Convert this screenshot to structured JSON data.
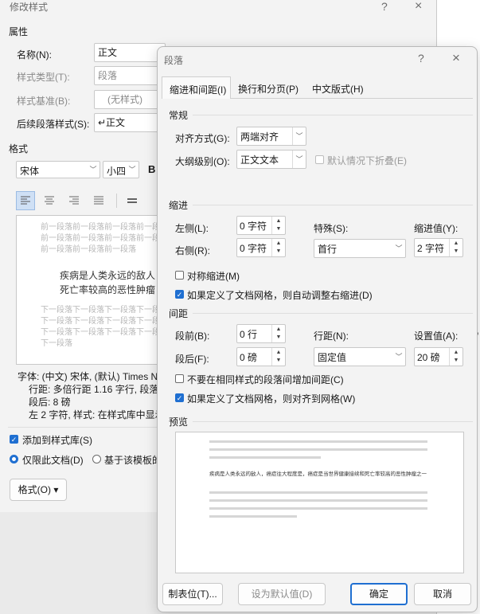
{
  "back": {
    "title": "修改样式",
    "help": "?",
    "close": "×",
    "properties_header": "属性",
    "name_label": "名称(N):",
    "name_value": "正文",
    "type_label": "样式类型(T):",
    "type_value": "段落",
    "based_label": "样式基准(B):",
    "based_value": "(无样式)",
    "next_label": "后续段落样式(S):",
    "next_value": "↵正文",
    "format_header": "格式",
    "font_value": "宋体",
    "size_value": "小四",
    "bold": "B",
    "preview_prev": [
      "前一段落前一段落前一段落前一段",
      "前一段落前一段落前一段落前一段",
      "前一段落前一段落前一段落"
    ],
    "preview_main": [
      "疾病是人类永远的敌人",
      "死亡率较高的恶性肿瘤"
    ],
    "preview_next": [
      "下一段落下一段落下一段落下一段",
      "下一段落下一段落下一段落下一段",
      "下一段落下一段落下一段落下一段",
      "下一段落"
    ],
    "desc": [
      "字体: (中文) 宋体, (默认) Times Ne",
      "行距: 多倍行距 1.16 字行, 段落",
      "段后: 8 磅",
      "左  2 字符, 样式: 在样式库中显示"
    ],
    "add_to_gallery": "添加到样式库(S)",
    "only_doc": "仅限此文档(D)",
    "based_template": "基于该模板的",
    "format_button": "格式(O) ▾"
  },
  "dialog": {
    "title": "段落",
    "help": "?",
    "close": "×",
    "tabs": [
      "缩进和间距(I)",
      "换行和分页(P)",
      "中文版式(H)"
    ],
    "general_header": "常规",
    "align_label": "对齐方式(G):",
    "align_value": "两端对齐",
    "outline_label": "大纲级别(O):",
    "outline_value": "正文文本",
    "collapsed_label": "默认情况下折叠(E)",
    "indent_header": "缩进",
    "left_label": "左侧(L):",
    "left_value": "0 字符",
    "right_label": "右侧(R):",
    "right_value": "0 字符",
    "special_label": "特殊(S):",
    "special_value": "首行",
    "indent_by_label": "缩进值(Y):",
    "indent_by_value": "2 字符",
    "mirror_label": "对称缩进(M)",
    "auto_adjust_label": "如果定义了文档网格，则自动调整右缩进(D)",
    "spacing_header": "间距",
    "before_label": "段前(B):",
    "before_value": "0 行",
    "after_label": "段后(F):",
    "after_value": "0 磅",
    "line_label": "行距(N):",
    "line_value": "固定值",
    "at_label": "设置值(A):",
    "at_value": "20 磅",
    "no_space_label": "不要在相同样式的段落间增加间距(C)",
    "snap_grid_label": "如果定义了文档网格，则对齐到网格(W)",
    "preview_header": "预览",
    "preview_text": "疾病是人类永远的敌人，癌症往大程度是，癌症是当世界健康接续和死亡率较高的恶性肿瘤之一",
    "tabs_button": "制表位(T)...",
    "default_button": "设为默认值(D)",
    "ok_button": "确定",
    "cancel_button": "取消"
  }
}
